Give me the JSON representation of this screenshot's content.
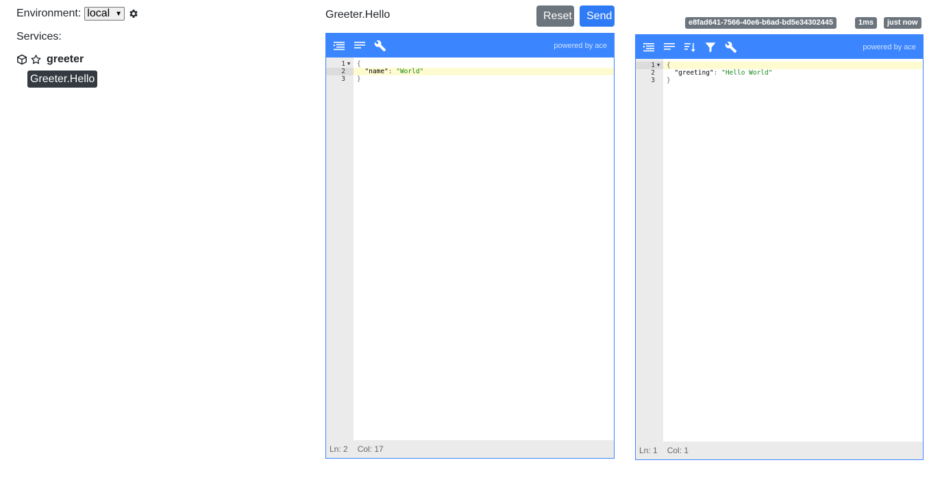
{
  "sidebar": {
    "environment_label": "Environment:",
    "environment_value": "local",
    "environment_options": [
      "local"
    ],
    "services_label": "Services:",
    "service_name": "greeter",
    "method_name": "Greeter.Hello"
  },
  "request": {
    "title": "Greeter.Hello",
    "reset_label": "Reset",
    "send_label": "Send",
    "powered": "powered by ace",
    "line_numbers": [
      "1",
      "2",
      "3"
    ],
    "line1": "{",
    "line2_key": "\"name\"",
    "line2_sep": ": ",
    "line2_value": "\"World\"",
    "line3": "}",
    "status_ln": "Ln: 2",
    "status_col": "Col: 17"
  },
  "response": {
    "request_id": "e8fad641-7566-40e6-b6ad-bd5e34302445",
    "duration": "1ms",
    "timestamp": "just now",
    "powered": "powered by ace",
    "line_numbers": [
      "1",
      "2",
      "3"
    ],
    "line1": "{",
    "line2_key": "\"greeting\"",
    "line2_sep": ": ",
    "line2_value": "\"Hello World\"",
    "line3": "}",
    "status_ln": "Ln: 1",
    "status_col": "Col: 1"
  },
  "colors": {
    "accent": "#3b86ff",
    "send": "#2f7bf5",
    "secondary": "#6c757d",
    "selected_method": "#343a40",
    "string": "#1a8a1a"
  },
  "icons": {
    "settings": "gear-icon",
    "service": "cube-icon",
    "favorite": "star-outline-icon",
    "format": "indent-icon",
    "compact": "align-icon",
    "sort": "sort-icon",
    "filter": "filter-icon",
    "tools": "wrench-icon"
  }
}
